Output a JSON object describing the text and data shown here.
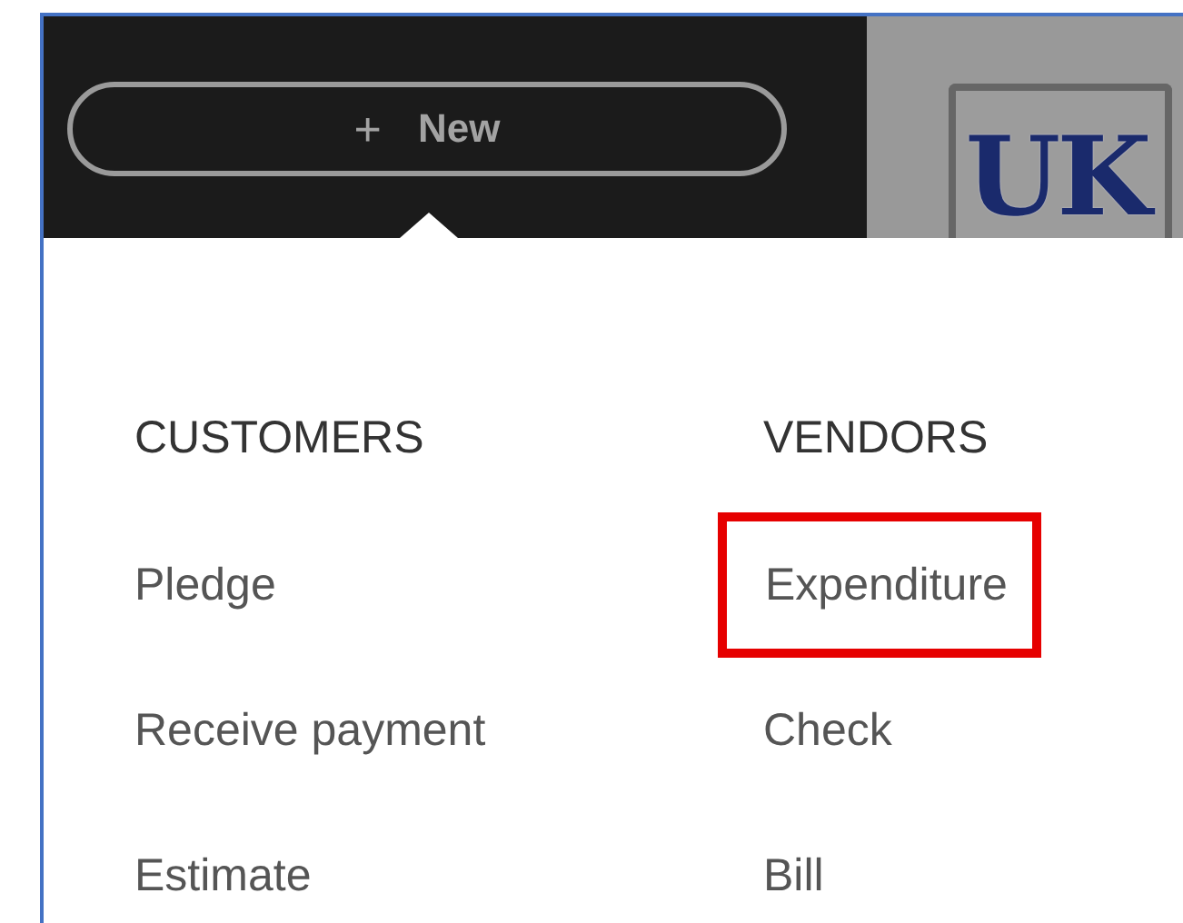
{
  "new_button": {
    "icon_text": "+",
    "label": "New"
  },
  "logo": {
    "text": "UK"
  },
  "menu": {
    "columns": [
      {
        "heading": "CUSTOMERS",
        "items": [
          {
            "label": "Pledge",
            "highlighted": false
          },
          {
            "label": "Receive payment",
            "highlighted": false
          },
          {
            "label": "Estimate",
            "highlighted": false
          }
        ]
      },
      {
        "heading": "VENDORS",
        "items": [
          {
            "label": "Expenditure",
            "highlighted": true
          },
          {
            "label": "Check",
            "highlighted": false
          },
          {
            "label": "Bill",
            "highlighted": false
          }
        ]
      }
    ]
  }
}
